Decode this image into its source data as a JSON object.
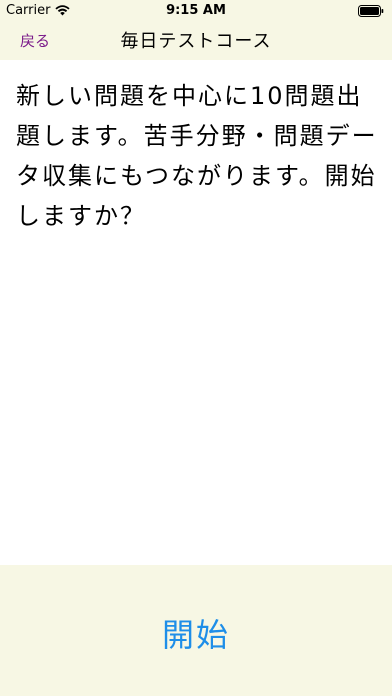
{
  "status_bar": {
    "carrier": "Carrier",
    "time": "9:15 AM"
  },
  "nav": {
    "back_label": "戻る",
    "title": "毎日テストコース"
  },
  "content": {
    "message": "新しい問題を中心に10問題出題します。苦手分野・問題データ収集にもつながります。開始しますか？"
  },
  "footer": {
    "start_label": "開始"
  },
  "colors": {
    "bar_background": "#f7f7e4",
    "back_text": "#7b1b8a",
    "start_text": "#1e8ee8"
  },
  "icons": [
    "wifi-icon",
    "battery-icon"
  ]
}
